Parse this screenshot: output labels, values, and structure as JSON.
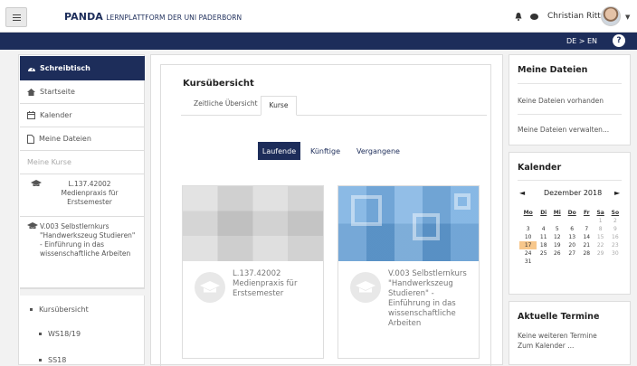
{
  "header": {
    "brand_bold": "PANDA",
    "brand_rest": "Lernplattform der Uni Paderborn",
    "user_name": "Christian Ritter",
    "lang": "DE > EN",
    "help": "?"
  },
  "sidebar": {
    "active": "Schreibtisch",
    "items": [
      "Startseite",
      "Kalender",
      "Meine Dateien",
      "Meine Kurse"
    ],
    "courses": [
      {
        "code": "L.137.42002",
        "name": "Medienpraxis für Erstsemester"
      },
      {
        "code": "V.003 Selbstlernkurs",
        "name": "\"Handwerkszeug Studieren\" - Einführung in das wissenschaftliche Arbeiten"
      }
    ],
    "overview": "Kursübersicht",
    "semesters": [
      "WS18/19",
      "SS18"
    ]
  },
  "main": {
    "title": "Kursübersicht",
    "tabs": [
      "Zeitliche Übersicht",
      "Kurse"
    ],
    "filters": [
      "Laufende",
      "Künftige",
      "Vergangene"
    ],
    "cards": [
      {
        "title": "L.137.42002 Medienpraxis für Erstsemester"
      },
      {
        "title": "V.003 Selbstlernkurs \"Handwerkszeug Studieren\" - Einführung in das wissenschaftliche Arbeiten"
      }
    ]
  },
  "files_block": {
    "title": "Meine Dateien",
    "empty": "Keine Dateien vorhanden",
    "manage": "Meine Dateien verwalten..."
  },
  "calendar": {
    "title": "Kalender",
    "prev": "◄",
    "month": "Dezember 2018",
    "next": "►",
    "weekdays": [
      "Mo",
      "Di",
      "Mi",
      "Do",
      "Fr",
      "Sa",
      "So"
    ],
    "weeks": [
      [
        "",
        "",
        "",
        "",
        "",
        "1",
        "2"
      ],
      [
        "3",
        "4",
        "5",
        "6",
        "7",
        "8",
        "9"
      ],
      [
        "10",
        "11",
        "12",
        "13",
        "14",
        "15",
        "16"
      ],
      [
        "17",
        "18",
        "19",
        "20",
        "21",
        "22",
        "23"
      ],
      [
        "24",
        "25",
        "26",
        "27",
        "28",
        "29",
        "30"
      ],
      [
        "31",
        "",
        "",
        "",
        "",
        "",
        ""
      ]
    ],
    "today": "17"
  },
  "events": {
    "title": "Aktuelle Termine",
    "none": "Keine weiteren Termine",
    "link": "Zum Kalender ..."
  },
  "colors": {
    "navy": "#1d2d5a",
    "today": "#f7c78b"
  }
}
